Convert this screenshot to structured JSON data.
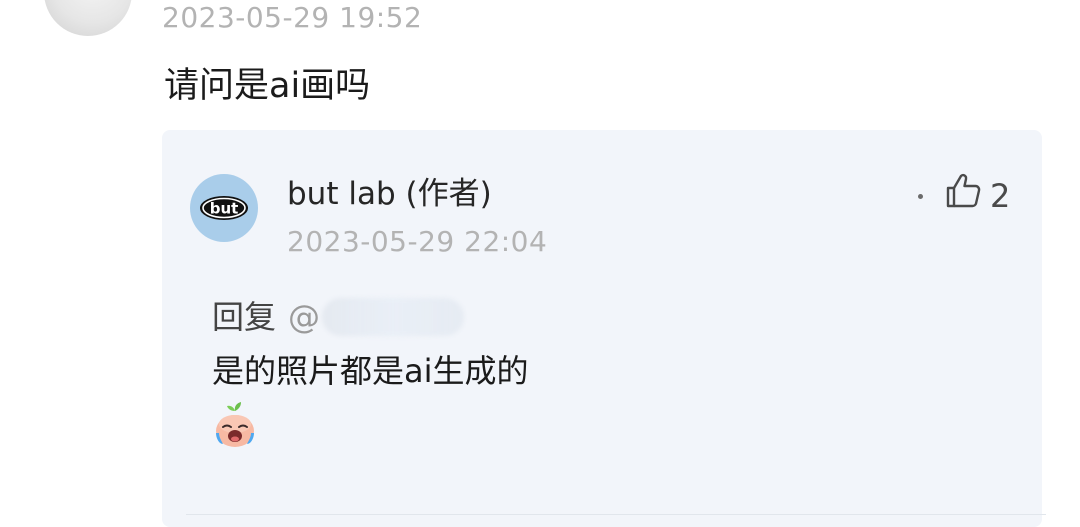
{
  "top_comment": {
    "timestamp": "2023-05-29 19:52",
    "text": "请问是ai画吗"
  },
  "reply": {
    "author": "but lab (作者)",
    "avatar_text": "but",
    "timestamp": "2023-05-29 22:04",
    "likes": "2",
    "prefix": "回复",
    "mention_at": "@",
    "text": "是的照片都是ai生成的",
    "emoji": "crying-sprout-emoji",
    "icons": {
      "like": "thumbs-up-icon",
      "more": "more-dot-icon"
    }
  },
  "colors": {
    "reply_background": "#f2f5fa",
    "timestamp": "#b3b3b3",
    "avatar_blue": "#a9cdea"
  }
}
